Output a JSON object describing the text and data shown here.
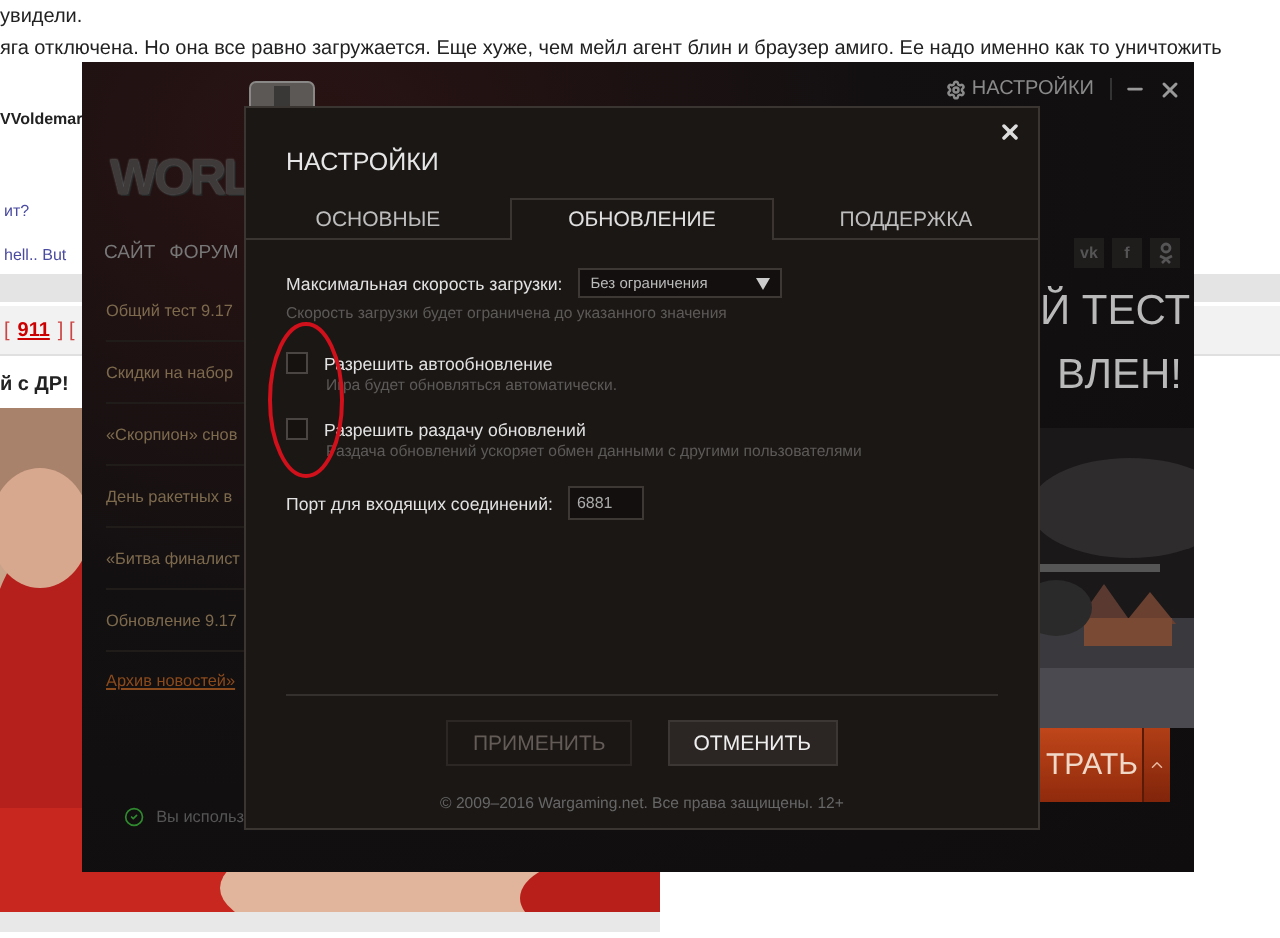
{
  "forum": {
    "lines": [
      "увидели.",
      "яга отключена. Но она все равно загружается. Еще хуже, чем мейл агент блин и браузер амиго. Ее надо именно как то уничтожить"
    ],
    "author": "VVoldemar",
    "snippets": [
      "ит?",
      "hell.. But"
    ],
    "pager": {
      "before": "[",
      "link": "911",
      "after": "] ["
    },
    "greeting": "й с ДР!",
    "photo": {
      "kind": "picture"
    }
  },
  "launcher": {
    "settings_link": "НАСТРОЙКИ",
    "logo_text": "WORL",
    "nav": [
      "САЙТ",
      "ФОРУМ"
    ],
    "social": [
      "vk",
      "f"
    ],
    "news": [
      "Общий тест 9.17",
      "Скидки на набор",
      "«Скорпион» снов",
      "День ракетных в",
      "«Битва финалист",
      "Обновление 9.17"
    ],
    "archive": "Архив новостей»",
    "status": "Вы использ",
    "banner": [
      "Й ТЕСТ",
      "ВЛЕН!"
    ],
    "play": "ТРАТЬ"
  },
  "dialog": {
    "title": "НАСТРОЙКИ",
    "tabs": [
      {
        "label": "ОСНОВНЫЕ",
        "selected": false
      },
      {
        "label": "ОБНОВЛЕНИЕ",
        "selected": true
      },
      {
        "label": "ПОДДЕРЖКА",
        "selected": false
      }
    ],
    "speed": {
      "label": "Максимальная скорость загрузки:",
      "value": "Без ограничения",
      "hint": "Скорость загрузки будет ограничена до указанного значения"
    },
    "options": [
      {
        "label": "Разрешить автообновление",
        "hint": "Игра будет обновляться автоматически.",
        "checked": false
      },
      {
        "label": "Разрешить раздачу обновлений",
        "hint": "Раздача обновлений ускоряет обмен данными с другими пользователями",
        "checked": false
      }
    ],
    "port": {
      "label": "Порт для входящих соединений:",
      "value": "6881"
    },
    "buttons": [
      {
        "label": "ПРИМЕНИТЬ",
        "disabled": true
      },
      {
        "label": "ОТМЕНИТЬ",
        "disabled": false
      }
    ],
    "copyright": "© 2009–2016 Wargaming.net. Все права защищены. 12+"
  }
}
